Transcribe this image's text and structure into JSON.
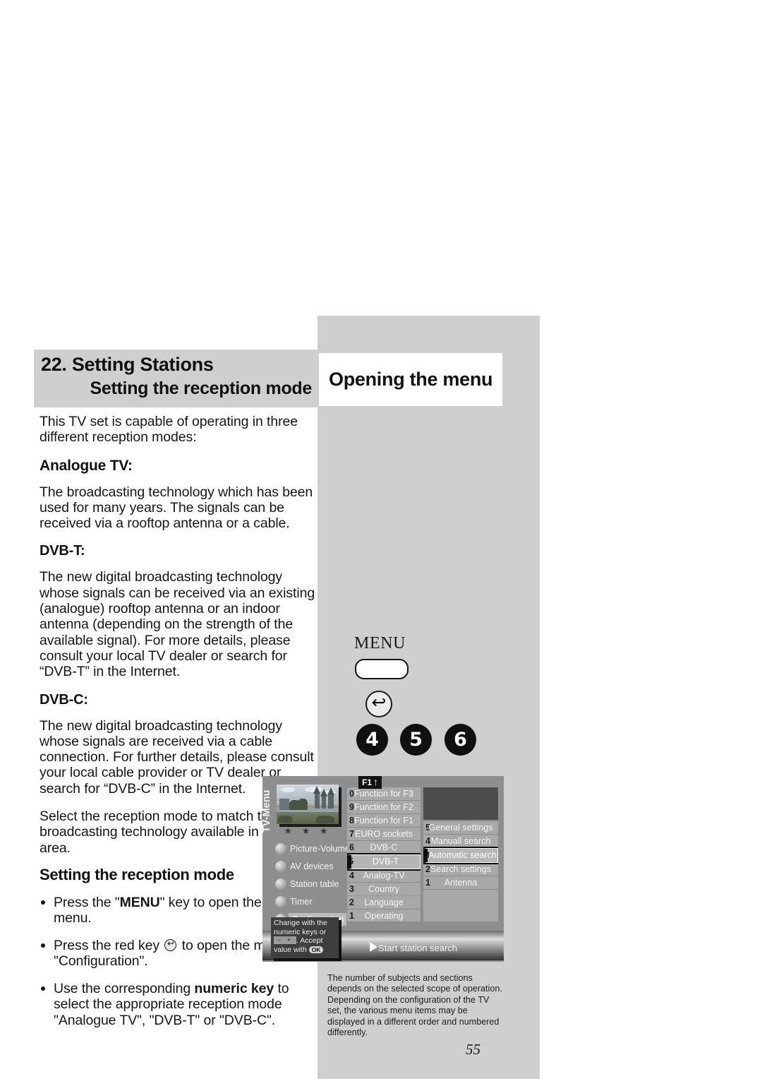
{
  "page": {
    "number": "55",
    "accent_grey": "#cfcfcf",
    "osd_grey": "#8e8e8e"
  },
  "header": {
    "chapter_number_and_title": "22. Setting Stations",
    "chapter_subtitle": "Setting the reception mode",
    "section_title": "Opening the menu"
  },
  "body": {
    "intro": "This TV set is capable of operating in three different reception modes:",
    "analogue_heading": "Analogue TV:",
    "analogue_text": "The broadcasting technology which has been used for many years. The signals can be received via a rooftop antenna or a cable.",
    "dvbt_heading": "DVB-T:",
    "dvbt_text": "The new digital broadcasting technology whose signals can be received via an existing (analogue) rooftop antenna or an indoor antenna (depending on the strength of the available signal). For more details, please consult your local TV dealer or search for “DVB-T” in the Internet.",
    "dvbc_heading": "DVB-C:",
    "dvbc_text": "The new digital broadcasting technology whose signals are received via a cable connection. For further details, please consult your local cable provider or TV dealer or search for “DVB-C” in the Internet.",
    "select_text": "Select the reception mode to match the broadcasting technology available in your area.",
    "procedure_heading": "Setting the reception mode",
    "bullets": [
      {
        "before": "Press the \"",
        "bold": "MENU",
        "after": "\" key to open the TV menu."
      },
      {
        "before": "Press the red key ",
        "bold": "",
        "after": " to open the menu \"Configuration\"."
      },
      {
        "before": "Use the corresponding ",
        "bold": "numeric key",
        "after": " to select the appropriate reception mode \"Analogue TV\", \"DVB-T\" or \"DVB-C\"."
      }
    ]
  },
  "remote": {
    "menu_label": "MENU",
    "back_key_name": "back-arrow-key",
    "numeric_keys": [
      "4",
      "5",
      "6"
    ]
  },
  "osd": {
    "vertical_label": "TV-Menu",
    "stars": "★ ★ ★",
    "f1_badge": "F1",
    "left_items": [
      {
        "label": "Picture-Volume",
        "highlighted": false
      },
      {
        "label": "AV devices",
        "highlighted": false
      },
      {
        "label": "Station table",
        "highlighted": false
      },
      {
        "label": "Timer",
        "highlighted": false
      },
      {
        "label": "Configuration",
        "highlighted": true
      }
    ],
    "middle_items": [
      {
        "num": "0",
        "label": "Function for F3",
        "selected": false
      },
      {
        "num": "9",
        "label": "Function for F2",
        "selected": false
      },
      {
        "num": "8",
        "label": "Function for F1",
        "selected": false
      },
      {
        "num": "7",
        "label": "EURO sockets",
        "selected": false
      },
      {
        "num": "6",
        "label": "DVB-C",
        "selected": false
      },
      {
        "num": "5",
        "label": "DVB-T",
        "selected": true
      },
      {
        "num": "4",
        "label": "Analog-TV",
        "selected": false
      },
      {
        "num": "3",
        "label": "Country",
        "selected": false
      },
      {
        "num": "2",
        "label": "Language",
        "selected": false
      },
      {
        "num": "1",
        "label": "Operating",
        "selected": false
      }
    ],
    "right_items": [
      {
        "num": "5",
        "label": "General settings",
        "selected": false
      },
      {
        "num": "4",
        "label": "Manuall search",
        "selected": false
      },
      {
        "num": "3",
        "label": "Automatic search",
        "selected": true
      },
      {
        "num": "2",
        "label": "Search settings",
        "selected": false
      },
      {
        "num": "1",
        "label": "Antenna",
        "selected": false
      }
    ],
    "hint_line1": "Change with the",
    "hint_line2": "numeric keys or",
    "hint_pm": "− +",
    "hint_line3": ". Accept",
    "hint_line4": "value with",
    "hint_ok": "OK",
    "start_search": "Start station search"
  },
  "caption": "The number of subjects and sections depends on the selected scope of operation. Depending on the configuration of the TV set, the various menu items may be displayed in a different order and numbered differently."
}
